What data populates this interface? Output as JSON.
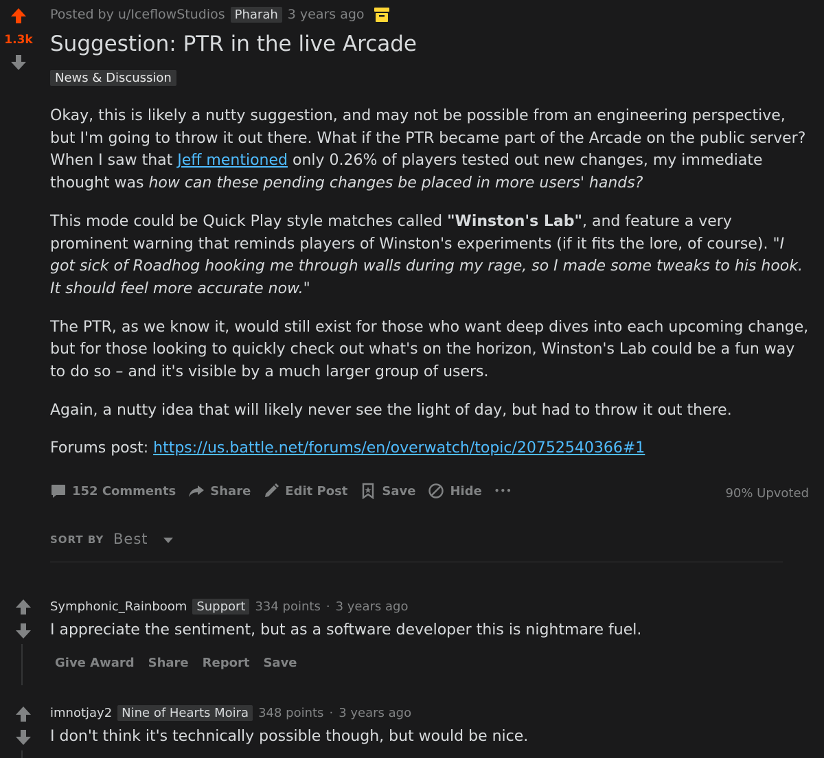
{
  "post": {
    "score": "1.3k",
    "posted_by": "Posted by u/IceflowStudios",
    "author_flair": "Pharah",
    "time": "3 years ago",
    "title": "Suggestion: PTR in the live Arcade",
    "flair": "News & Discussion",
    "body": {
      "p1_a": "Okay, this is likely a nutty suggestion, and may not be possible from an engineering perspective, but I'm going to throw it out there. What if the PTR became part of the Arcade on the public server? When I saw that ",
      "p1_link": "Jeff mentioned",
      "p1_b": " only 0.26% of players tested out new changes, my immediate thought was ",
      "p1_em": "how can these pending changes be placed in more users' hands?",
      "p2_a": "This mode could be Quick Play style matches called ",
      "p2_strong": "\"Winston's Lab\"",
      "p2_b": ", and feature a very prominent warning that reminds players of Winston's experiments (if it fits the lore, of course). ",
      "p2_em": "\"I got sick of Roadhog hooking me through walls during my rage, so I made some tweaks to his hook. It should feel more accurate now.\"",
      "p3": "The PTR, as we know it, would still exist for those who want deep dives into each upcoming change, but for those looking to quickly check out what's on the horizon, Winston's Lab could be a fun way to do so – and it's visible by a much larger group of users.",
      "p4": "Again, a nutty idea that will likely never see the light of day, but had to throw it out there.",
      "p5_label": "Forums post: ",
      "p5_link": "https://us.battle.net/forums/en/overwatch/topic/20752540366#1"
    },
    "actions": {
      "comments": "152 Comments",
      "share": "Share",
      "edit": "Edit Post",
      "save": "Save",
      "hide": "Hide",
      "more": "•••"
    },
    "upvoted": "90% Upvoted"
  },
  "sort": {
    "label": "SORT BY",
    "value": "Best"
  },
  "comments": [
    {
      "author": "Symphonic_Rainboom",
      "flair": "Support",
      "points": "334 points",
      "sep": "·",
      "time": "3 years ago",
      "text": "I appreciate the sentiment, but as a software developer this is nightmare fuel.",
      "actions": [
        "Give Award",
        "Share",
        "Report",
        "Save"
      ]
    },
    {
      "author": "imnotjay2",
      "flair": "Nine of Hearts Moira",
      "points": "348 points",
      "sep": "·",
      "time": "3 years ago",
      "text": "I don't think it's technically possible though, but would be nice."
    }
  ],
  "colors": {
    "background": "#1a1a1b",
    "upvote_active": "#ff4500",
    "link": "#4fbcff",
    "muted": "#818384",
    "archive_icon": "#ffd635"
  }
}
